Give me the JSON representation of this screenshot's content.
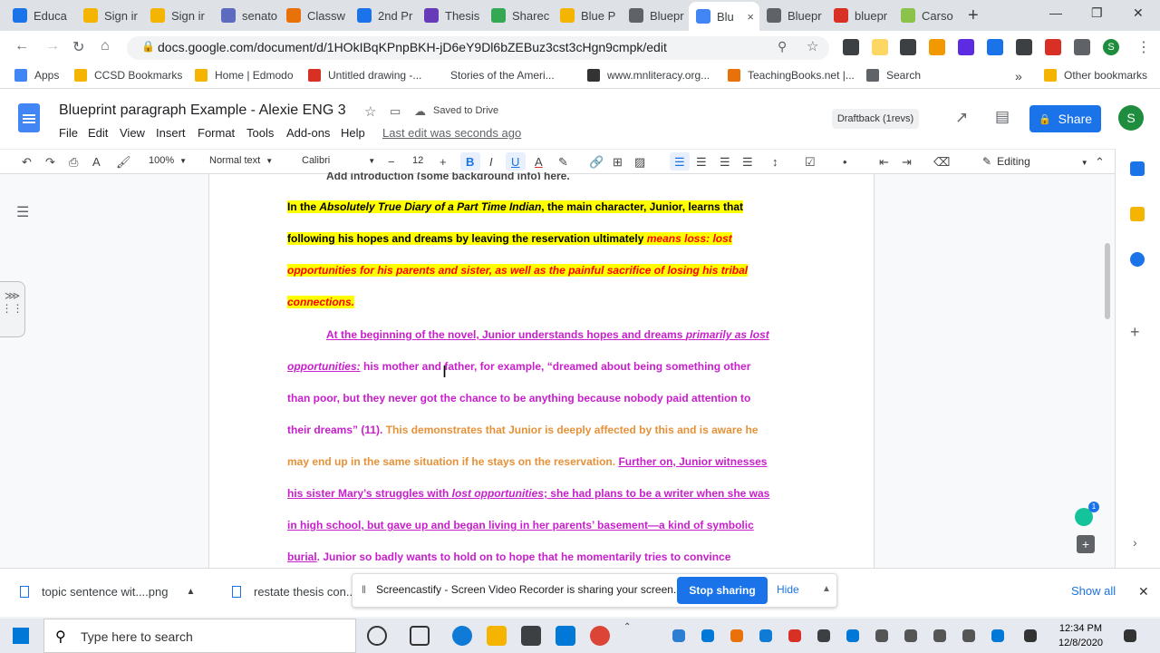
{
  "browser": {
    "tabs": [
      {
        "label": "Educa",
        "color": "#1a73e8"
      },
      {
        "label": "Sign ir",
        "color": "#f4b400"
      },
      {
        "label": "Sign ir",
        "color": "#f4b400"
      },
      {
        "label": "senato",
        "color": "#5c6bc0"
      },
      {
        "label": "Classw",
        "color": "#e8710a"
      },
      {
        "label": "2nd Pr",
        "color": "#1a73e8"
      },
      {
        "label": "Thesis",
        "color": "#673ab7"
      },
      {
        "label": "Sharec",
        "color": "#34a853"
      },
      {
        "label": "Blue P",
        "color": "#f4b400"
      },
      {
        "label": "Bluepr",
        "color": "#5f6368"
      },
      {
        "label": "Blu",
        "color": "#4285f4"
      },
      {
        "label": "Bluepr",
        "color": "#5f6368"
      },
      {
        "label": "bluepr",
        "color": "#d93025"
      },
      {
        "label": "Carso",
        "color": "#8bc34a"
      }
    ],
    "active_tab_close": "×",
    "new_tab": "+",
    "url": "docs.google.com/document/d/1HOkIBqKPnpBKH-jD6eY9Dl6bZEBuz3cst3cHgn9cmpk/edit",
    "bookmarks": [
      {
        "label": "Apps",
        "color": "#4285f4"
      },
      {
        "label": "CCSD Bookmarks",
        "color": "#f4b400"
      },
      {
        "label": "Home | Edmodo",
        "color": "#f4b400"
      },
      {
        "label": "Untitled drawing -...",
        "color": "#d93025"
      },
      {
        "label": "Stories of the Ameri...",
        "color": "#ffffff"
      },
      {
        "label": "www.mnliteracy.org...",
        "color": "#333333"
      },
      {
        "label": "TeachingBooks.net |...",
        "color": "#e8710a"
      },
      {
        "label": "Search",
        "color": "#5f6368"
      },
      {
        "label": "Other bookmarks",
        "color": "#f4b400"
      }
    ],
    "bookmarks_more": "»",
    "avatar": "S"
  },
  "doc": {
    "title": "Blueprint paragraph Example - Alexie ENG 3",
    "saved": "Saved to Drive",
    "menus": [
      "File",
      "Edit",
      "View",
      "Insert",
      "Format",
      "Tools",
      "Add-ons",
      "Help"
    ],
    "last_edit": "Last edit was seconds ago",
    "draftback": "Draftback (1revs)",
    "share": "Share",
    "avatar": "S"
  },
  "toolbar": {
    "zoom": "100%",
    "style": "Normal text",
    "font": "Calibri",
    "size": "12",
    "mode": "Editing"
  },
  "content": {
    "ghost": "Add introduction (some background info) here.",
    "topic": {
      "l1a": "In the ",
      "l1b": "Absolutely True Diary of a Part Time Indian",
      "l1c": ", the main character, Junior, learns that",
      "l2a": "following his hopes and dreams by leaving the reservation ultimately ",
      "l2b": "means loss:   lost",
      "l3": "opportunities for his parents and sister, as well as the painful sacrifice of losing his tribal",
      "l4": "connections."
    },
    "body": {
      "l1a": "At the beginning of the novel, Junior understands hopes and dreams ",
      "l1b": "primarily as lost",
      "l2a": "opportunities:",
      "l2b": " his mother and father, for example, “dreamed about being something other",
      "l3": "than poor, but they never got the chance to be anything because nobody paid attention to",
      "l4a": "their dreams” (11). ",
      "l4b": "This demonstrates that Junior is deeply affected by this and is aware he",
      "l5a": "may end up in the same situation if he stays on the reservation. ",
      "l5b": "Further on, Junior witnesses",
      "l6a": "his sister Mary’s struggles with ",
      "l6b": "lost opportunities",
      "l6c": "; she had plans to be a writer when she was",
      "l7": "in high school, but gave up and began living in her parents’ basement—a kind of symbolic",
      "l8a": "burial",
      "l8b": ".  Junior so badly wants to hold on to hope that he momentarily tries to convince"
    }
  },
  "grammarly_count": "1",
  "downloads": {
    "items": [
      "topic sentence wit....png",
      "restate thesis con..."
    ],
    "show_all": "Show all"
  },
  "screencastify": {
    "message": "Screencastify - Screen Video Recorder is sharing your screen.",
    "stop": "Stop sharing",
    "hide": "Hide"
  },
  "taskbar": {
    "search_placeholder": "Type here to search",
    "time": "12:34 PM",
    "date": "12/8/2020"
  }
}
